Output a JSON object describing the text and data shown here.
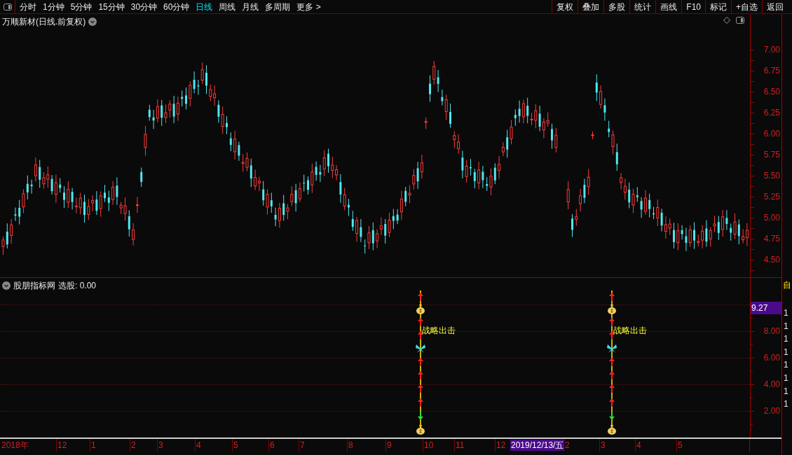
{
  "toolbar": {
    "periods": [
      {
        "label": "分时",
        "selected": false
      },
      {
        "label": "1分钟",
        "selected": false
      },
      {
        "label": "5分钟",
        "selected": false
      },
      {
        "label": "15分钟",
        "selected": false
      },
      {
        "label": "30分钟",
        "selected": false
      },
      {
        "label": "60分钟",
        "selected": false
      },
      {
        "label": "日线",
        "selected": true
      },
      {
        "label": "周线",
        "selected": false
      },
      {
        "label": "月线",
        "selected": false
      },
      {
        "label": "多周期",
        "selected": false
      },
      {
        "label": "更多 >",
        "selected": false
      }
    ],
    "actions": [
      "复权",
      "叠加",
      "多股",
      "统计",
      "画线",
      "F10",
      "标记",
      "+自选",
      "返回"
    ]
  },
  "price_chart": {
    "title": "万顺新材(日线.前复权)",
    "axis_labels": [
      "7.00",
      "6.75",
      "6.50",
      "6.25",
      "6.00",
      "5.75",
      "5.50",
      "5.25",
      "5.00",
      "4.75",
      "4.50"
    ]
  },
  "indicator_panel": {
    "title": "股朋指标网",
    "value_label": "选股: 0.00",
    "current_value": "9.27",
    "axis_labels": [
      "8.00",
      "6.00",
      "4.00",
      "2.00"
    ],
    "signals": [
      {
        "label": "战略出击"
      },
      {
        "label": "战略出击"
      }
    ]
  },
  "side_strip": {
    "header": "自",
    "rows": [
      "1",
      "1",
      "1",
      "1",
      "1",
      "1",
      "1",
      "1"
    ]
  },
  "time_axis": {
    "labels": [
      "2018年",
      "12",
      "1",
      "2",
      "3",
      "4",
      "5",
      "6",
      "7",
      "8",
      "9",
      "10",
      "11",
      "12",
      "2",
      "3",
      "4",
      "5"
    ],
    "cursor_date": "2019/12/13/五"
  }
}
